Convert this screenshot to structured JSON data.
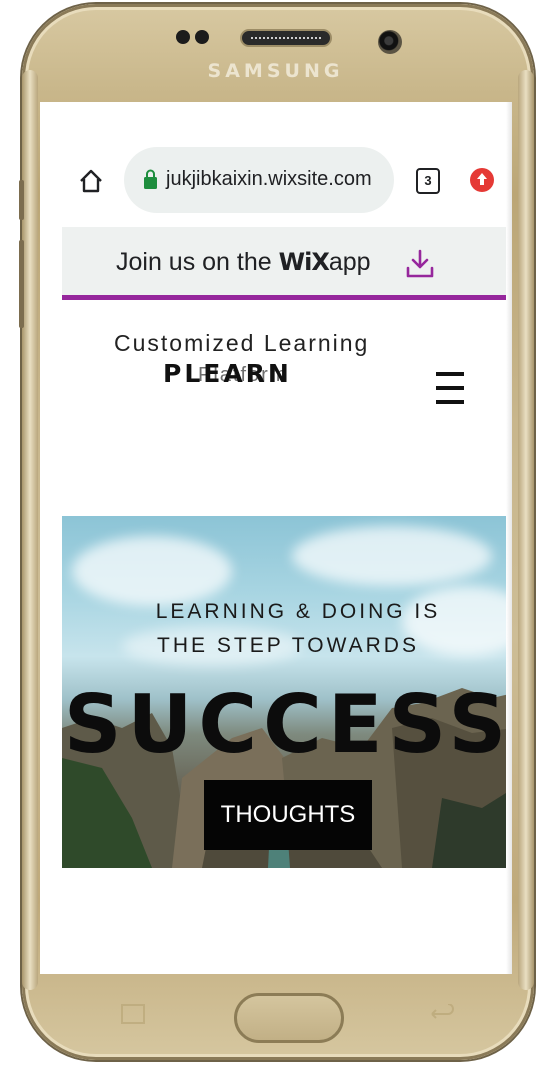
{
  "device": {
    "brand": "SAMSUNG"
  },
  "browser": {
    "url": "jukjibkaixin.wixsite.com",
    "tabs_count": "3"
  },
  "banner": {
    "prefix": "Join us on the ",
    "wix": "WiX",
    "suffix": "app"
  },
  "site": {
    "logo_top": "Customized Learning",
    "logo_main": "PLEARN",
    "logo_sub": "Platform"
  },
  "hero": {
    "line1": "LEARNING & DOING  IS",
    "line2": "THE  STEP TOWARDS",
    "headline": "SUCCESS",
    "button_label": "THOUGHTS"
  },
  "colors": {
    "banner_accent": "#96279c",
    "secure_lock": "#1e8e3e",
    "extension": "#e53935"
  }
}
